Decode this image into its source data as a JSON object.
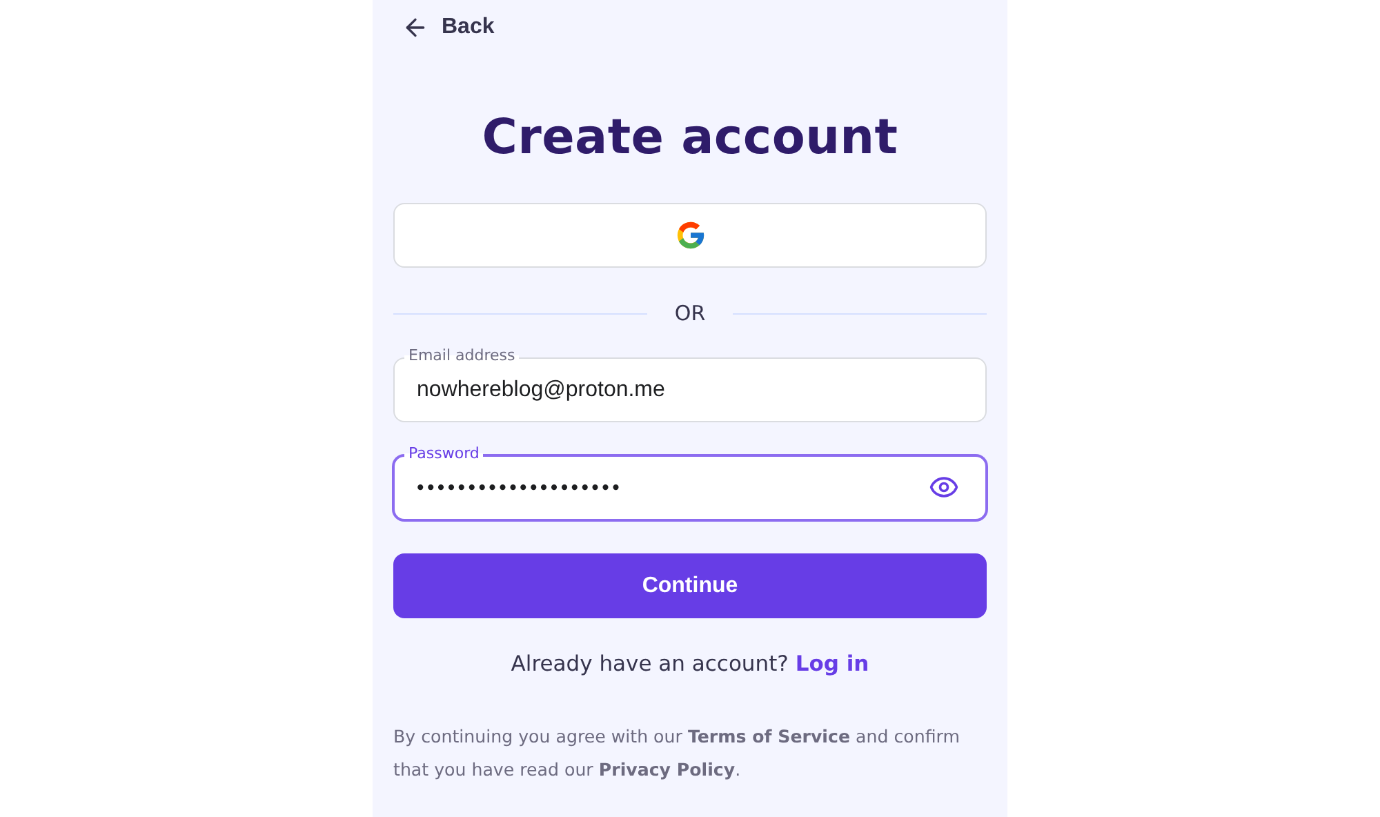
{
  "back": {
    "label": "Back"
  },
  "title": "Create account",
  "divider": {
    "label": "OR"
  },
  "fields": [
    {
      "kind": "text",
      "label": "Email address",
      "value": "nowhereblog@proton.me",
      "focused": false
    },
    {
      "kind": "password",
      "label": "Password",
      "value": "••••••••••••••••••••",
      "focused": true
    }
  ],
  "continue_button": {
    "label": "Continue"
  },
  "login_prompt": {
    "text": "Already have an account?",
    "link": "Log in"
  },
  "terms": {
    "before": "By continuing you agree with our",
    "link_1": "Terms of Service",
    "middle": "and confirm that you have read our",
    "link_2": "Privacy Policy",
    "after": "."
  }
}
